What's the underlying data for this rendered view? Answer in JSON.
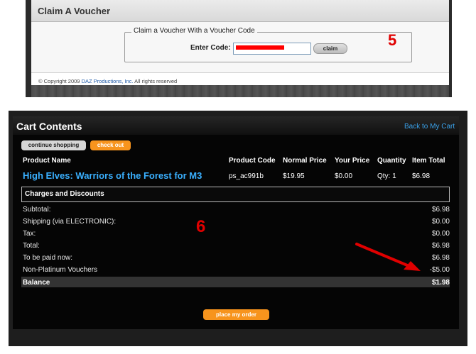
{
  "voucher": {
    "title": "Claim A Voucher",
    "legend": "Claim a Voucher With a Voucher Code",
    "enter_code_label": "Enter Code:",
    "code_value": "",
    "claim_label": "claim",
    "annotation": "5",
    "copyright_prefix": "© Copyright 2009 ",
    "copyright_link": "DAZ Productions, Inc.",
    "copyright_suffix": " All rights reserved"
  },
  "cart": {
    "title": "Cart Contents",
    "back_link": "Back to My Cart",
    "continue_label": "continue shopping",
    "checkout_label": "check out",
    "columns": [
      "Product Name",
      "Product Code",
      "Normal Price",
      "Your Price",
      "Quantity",
      "Item Total"
    ],
    "item": {
      "name": "High Elves: Warriors of the Forest for M3",
      "code": "ps_ac991b",
      "normal_price": "$19.95",
      "your_price": "$0.00",
      "quantity": "Qty: 1",
      "item_total": "$6.98"
    },
    "charges_title": "Charges and Discounts",
    "summary": [
      {
        "label": "Subtotal:",
        "value": "$6.98"
      },
      {
        "label": "Shipping (via ELECTRONIC):",
        "value": "$0.00"
      },
      {
        "label": "Tax:",
        "value": "$0.00"
      },
      {
        "label": "Total:",
        "value": "$6.98"
      },
      {
        "label": "To be paid now:",
        "value": "$6.98"
      },
      {
        "label": "Non-Platinum Vouchers",
        "value": "-$5.00"
      }
    ],
    "balance": {
      "label": "Balance",
      "value": "$1.98"
    },
    "annotation": "6",
    "place_order_label": "place my order"
  },
  "colors": {
    "accent_orange": "#f7941d",
    "link_blue": "#3aa0e8",
    "annotation_red": "#e00000"
  }
}
